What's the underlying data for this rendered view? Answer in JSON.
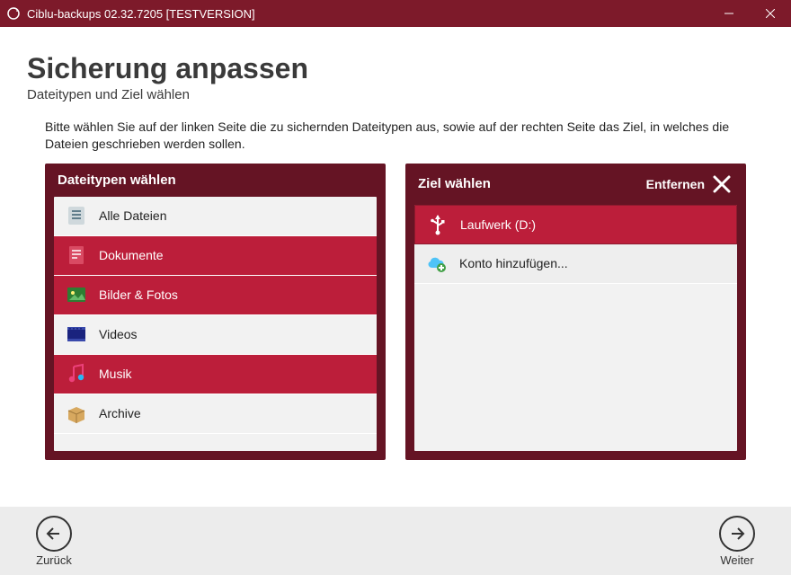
{
  "window": {
    "title": "Ciblu-backups 02.32.7205 [TESTVERSION]"
  },
  "page": {
    "title": "Sicherung anpassen",
    "subtitle": "Dateitypen und Ziel wählen",
    "instruction": "Bitte wählen Sie auf der linken Seite die zu sichernden Dateitypen aus, sowie auf der rechten Seite das Ziel, in welches die Dateien geschrieben werden sollen."
  },
  "panels": {
    "filetypes": {
      "header": "Dateitypen wählen",
      "items": [
        {
          "icon": "all-files",
          "label": "Alle Dateien",
          "selected": false
        },
        {
          "icon": "document",
          "label": "Dokumente",
          "selected": true
        },
        {
          "icon": "photos",
          "label": "Bilder & Fotos",
          "selected": true
        },
        {
          "icon": "video",
          "label": "Videos",
          "selected": false
        },
        {
          "icon": "music",
          "label": "Musik",
          "selected": true
        },
        {
          "icon": "archive",
          "label": "Archive",
          "selected": false
        }
      ]
    },
    "target": {
      "header": "Ziel wählen",
      "remove_label": "Entfernen",
      "items": [
        {
          "icon": "usb",
          "label": "Laufwerk (D:)",
          "selected": true
        },
        {
          "icon": "cloud-add",
          "label": "Konto hinzufügen...",
          "selected": false
        }
      ]
    }
  },
  "footer": {
    "back": "Zurück",
    "next": "Weiter"
  }
}
